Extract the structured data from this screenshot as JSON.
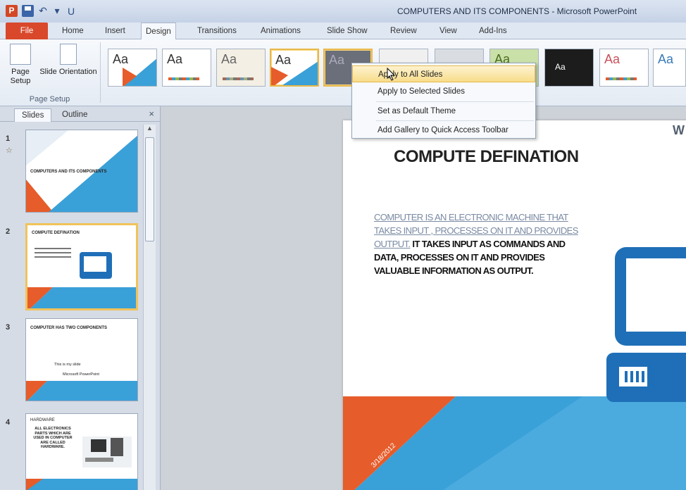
{
  "window": {
    "title": "COMPUTERS AND ITS COMPONENTS  -  Microsoft PowerPoint",
    "app_logo": "P"
  },
  "qat": {
    "undo_glyph": "↶",
    "repeat_glyph": "U",
    "dropdown_glyph": "▾"
  },
  "ribbon_tabs": {
    "file": "File",
    "home": "Home",
    "insert": "Insert",
    "design": "Design",
    "transitions": "Transitions",
    "animations": "Animations",
    "slideshow": "Slide Show",
    "review": "Review",
    "view": "View",
    "addins": "Add-Ins"
  },
  "page_setup": {
    "page_setup_label": "Page Setup",
    "slide_orientation_label": "Slide Orientation",
    "group_label": "Page Setup"
  },
  "themes": {
    "label": "Aa",
    "colors": {
      "orange": "#e65c2a",
      "blue": "#3aa0d8",
      "dark": "#1c1c1c",
      "gray": "#6b6f7a"
    }
  },
  "context_menu": {
    "items": [
      "Apply to All Slides",
      "Apply to Selected Slides",
      "Set as Default Theme",
      "Add Gallery to Quick Access Toolbar"
    ]
  },
  "pane": {
    "tab_slides": "Slides",
    "tab_outline": "Outline",
    "close": "×",
    "slides": [
      {
        "num": "1",
        "star": "☆",
        "title": "COMPUTERS AND ITS COMPONENTS"
      },
      {
        "num": "2",
        "title": "COMPUTE DEFINATION"
      },
      {
        "num": "3",
        "title": "COMPUTER HAS TWO COMPONENTS",
        "line1": "This is my slide",
        "line2": "Microsoft PowerPoint"
      },
      {
        "num": "4",
        "title": "HARDWARE",
        "body": "ALL ELECTRONICS PARTS WHICH ARE USED IN COMPUTER ARE CALLED HARDWARE."
      }
    ]
  },
  "slide": {
    "title": "COMPUTE DEFINATION",
    "body_link": "COMPUTER IS AN ELECTRONIC MACHINE THAT TAKES INPUT , PROCESSES ON IT AND PROVIDES OUTPUT.",
    "body_text": " IT TAKES INPUT AS COMMANDS AND DATA, PROCESSES ON IT AND PROVIDES VALUABLE INFORMATION AS OUTPUT.",
    "date": "3/18/2012",
    "corner_text": "W"
  }
}
